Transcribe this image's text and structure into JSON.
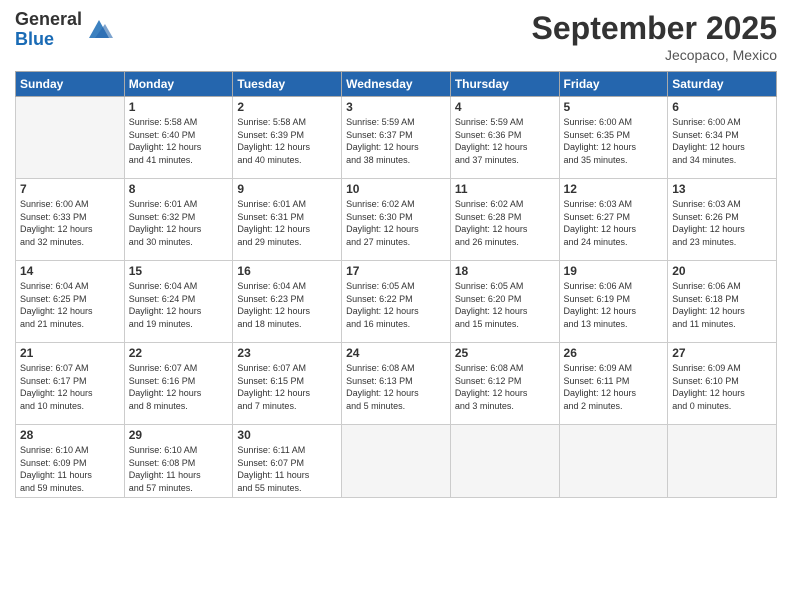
{
  "logo": {
    "general": "General",
    "blue": "Blue"
  },
  "title": "September 2025",
  "location": "Jecopaco, Mexico",
  "days_of_week": [
    "Sunday",
    "Monday",
    "Tuesday",
    "Wednesday",
    "Thursday",
    "Friday",
    "Saturday"
  ],
  "weeks": [
    [
      {
        "day": "",
        "info": ""
      },
      {
        "day": "1",
        "info": "Sunrise: 5:58 AM\nSunset: 6:40 PM\nDaylight: 12 hours\nand 41 minutes."
      },
      {
        "day": "2",
        "info": "Sunrise: 5:58 AM\nSunset: 6:39 PM\nDaylight: 12 hours\nand 40 minutes."
      },
      {
        "day": "3",
        "info": "Sunrise: 5:59 AM\nSunset: 6:37 PM\nDaylight: 12 hours\nand 38 minutes."
      },
      {
        "day": "4",
        "info": "Sunrise: 5:59 AM\nSunset: 6:36 PM\nDaylight: 12 hours\nand 37 minutes."
      },
      {
        "day": "5",
        "info": "Sunrise: 6:00 AM\nSunset: 6:35 PM\nDaylight: 12 hours\nand 35 minutes."
      },
      {
        "day": "6",
        "info": "Sunrise: 6:00 AM\nSunset: 6:34 PM\nDaylight: 12 hours\nand 34 minutes."
      }
    ],
    [
      {
        "day": "7",
        "info": "Sunrise: 6:00 AM\nSunset: 6:33 PM\nDaylight: 12 hours\nand 32 minutes."
      },
      {
        "day": "8",
        "info": "Sunrise: 6:01 AM\nSunset: 6:32 PM\nDaylight: 12 hours\nand 30 minutes."
      },
      {
        "day": "9",
        "info": "Sunrise: 6:01 AM\nSunset: 6:31 PM\nDaylight: 12 hours\nand 29 minutes."
      },
      {
        "day": "10",
        "info": "Sunrise: 6:02 AM\nSunset: 6:30 PM\nDaylight: 12 hours\nand 27 minutes."
      },
      {
        "day": "11",
        "info": "Sunrise: 6:02 AM\nSunset: 6:28 PM\nDaylight: 12 hours\nand 26 minutes."
      },
      {
        "day": "12",
        "info": "Sunrise: 6:03 AM\nSunset: 6:27 PM\nDaylight: 12 hours\nand 24 minutes."
      },
      {
        "day": "13",
        "info": "Sunrise: 6:03 AM\nSunset: 6:26 PM\nDaylight: 12 hours\nand 23 minutes."
      }
    ],
    [
      {
        "day": "14",
        "info": "Sunrise: 6:04 AM\nSunset: 6:25 PM\nDaylight: 12 hours\nand 21 minutes."
      },
      {
        "day": "15",
        "info": "Sunrise: 6:04 AM\nSunset: 6:24 PM\nDaylight: 12 hours\nand 19 minutes."
      },
      {
        "day": "16",
        "info": "Sunrise: 6:04 AM\nSunset: 6:23 PM\nDaylight: 12 hours\nand 18 minutes."
      },
      {
        "day": "17",
        "info": "Sunrise: 6:05 AM\nSunset: 6:22 PM\nDaylight: 12 hours\nand 16 minutes."
      },
      {
        "day": "18",
        "info": "Sunrise: 6:05 AM\nSunset: 6:20 PM\nDaylight: 12 hours\nand 15 minutes."
      },
      {
        "day": "19",
        "info": "Sunrise: 6:06 AM\nSunset: 6:19 PM\nDaylight: 12 hours\nand 13 minutes."
      },
      {
        "day": "20",
        "info": "Sunrise: 6:06 AM\nSunset: 6:18 PM\nDaylight: 12 hours\nand 11 minutes."
      }
    ],
    [
      {
        "day": "21",
        "info": "Sunrise: 6:07 AM\nSunset: 6:17 PM\nDaylight: 12 hours\nand 10 minutes."
      },
      {
        "day": "22",
        "info": "Sunrise: 6:07 AM\nSunset: 6:16 PM\nDaylight: 12 hours\nand 8 minutes."
      },
      {
        "day": "23",
        "info": "Sunrise: 6:07 AM\nSunset: 6:15 PM\nDaylight: 12 hours\nand 7 minutes."
      },
      {
        "day": "24",
        "info": "Sunrise: 6:08 AM\nSunset: 6:13 PM\nDaylight: 12 hours\nand 5 minutes."
      },
      {
        "day": "25",
        "info": "Sunrise: 6:08 AM\nSunset: 6:12 PM\nDaylight: 12 hours\nand 3 minutes."
      },
      {
        "day": "26",
        "info": "Sunrise: 6:09 AM\nSunset: 6:11 PM\nDaylight: 12 hours\nand 2 minutes."
      },
      {
        "day": "27",
        "info": "Sunrise: 6:09 AM\nSunset: 6:10 PM\nDaylight: 12 hours\nand 0 minutes."
      }
    ],
    [
      {
        "day": "28",
        "info": "Sunrise: 6:10 AM\nSunset: 6:09 PM\nDaylight: 11 hours\nand 59 minutes."
      },
      {
        "day": "29",
        "info": "Sunrise: 6:10 AM\nSunset: 6:08 PM\nDaylight: 11 hours\nand 57 minutes."
      },
      {
        "day": "30",
        "info": "Sunrise: 6:11 AM\nSunset: 6:07 PM\nDaylight: 11 hours\nand 55 minutes."
      },
      {
        "day": "",
        "info": ""
      },
      {
        "day": "",
        "info": ""
      },
      {
        "day": "",
        "info": ""
      },
      {
        "day": "",
        "info": ""
      }
    ]
  ]
}
